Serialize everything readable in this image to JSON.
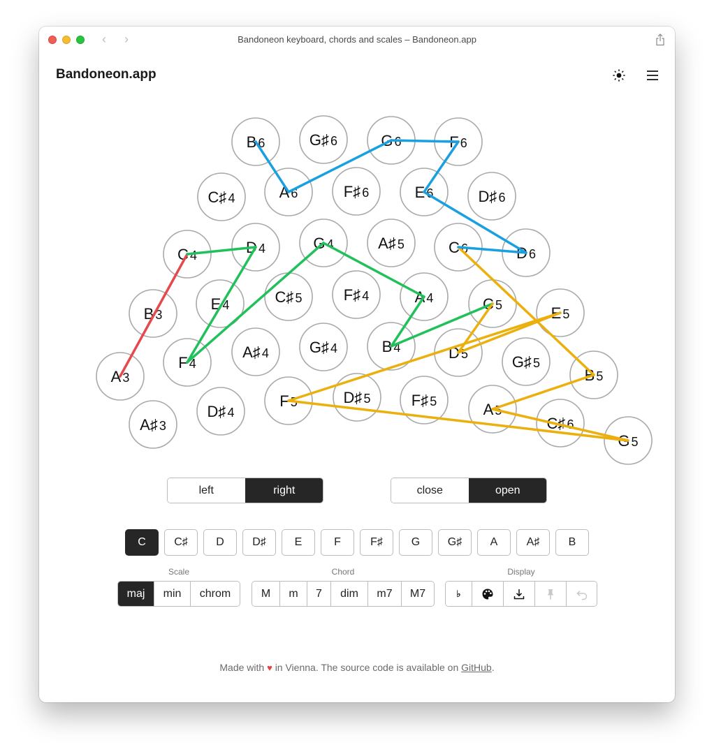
{
  "window": {
    "title": "Bandoneon keyboard, chords and scales – Bandoneon.app",
    "back_glyph": "‹",
    "forward_glyph": "›"
  },
  "header": {
    "app_title": "Bandoneon.app",
    "icons": [
      "theme-toggle-icon",
      "menu-icon"
    ]
  },
  "keyboard": {
    "side": "right",
    "direction": "open",
    "colors": {
      "octave3": "#e5484d",
      "octave4": "#22c05a",
      "octave5": "#ebb00e",
      "octave6": "#1a9fe0",
      "key_stroke": "#a9a9a9"
    },
    "keys": [
      {
        "note": "B",
        "octave": "6"
      },
      {
        "note": "G♯",
        "octave": "6"
      },
      {
        "note": "G",
        "octave": "6"
      },
      {
        "note": "F",
        "octave": "6"
      },
      {
        "note": "C♯",
        "octave": "4"
      },
      {
        "note": "A",
        "octave": "6"
      },
      {
        "note": "F♯",
        "octave": "6"
      },
      {
        "note": "E",
        "octave": "6"
      },
      {
        "note": "D♯",
        "octave": "6"
      },
      {
        "note": "C",
        "octave": "4"
      },
      {
        "note": "D",
        "octave": "4"
      },
      {
        "note": "G",
        "octave": "4"
      },
      {
        "note": "A♯",
        "octave": "5"
      },
      {
        "note": "C",
        "octave": "6"
      },
      {
        "note": "D",
        "octave": "6"
      },
      {
        "note": "B",
        "octave": "3"
      },
      {
        "note": "E",
        "octave": "4"
      },
      {
        "note": "C♯",
        "octave": "5"
      },
      {
        "note": "F♯",
        "octave": "4"
      },
      {
        "note": "A",
        "octave": "4"
      },
      {
        "note": "C",
        "octave": "5"
      },
      {
        "note": "E",
        "octave": "5"
      },
      {
        "note": "A",
        "octave": "3"
      },
      {
        "note": "F",
        "octave": "4"
      },
      {
        "note": "A♯",
        "octave": "4"
      },
      {
        "note": "G♯",
        "octave": "4"
      },
      {
        "note": "B",
        "octave": "4"
      },
      {
        "note": "D",
        "octave": "5"
      },
      {
        "note": "G♯",
        "octave": "5"
      },
      {
        "note": "B",
        "octave": "5"
      },
      {
        "note": "A♯",
        "octave": "3"
      },
      {
        "note": "D♯",
        "octave": "4"
      },
      {
        "note": "F",
        "octave": "5"
      },
      {
        "note": "D♯",
        "octave": "5"
      },
      {
        "note": "F♯",
        "octave": "5"
      },
      {
        "note": "A",
        "octave": "5"
      },
      {
        "note": "C♯",
        "octave": "6"
      },
      {
        "note": "G",
        "octave": "5"
      }
    ],
    "scale_path": [
      {
        "from": "A3",
        "to": "C4",
        "group": "octave3"
      },
      {
        "from": "C4",
        "to": "D4",
        "group": "octave4"
      },
      {
        "from": "D4",
        "to": "F4",
        "group": "octave4"
      },
      {
        "from": "F4",
        "to": "G4",
        "group": "octave4"
      },
      {
        "from": "G4",
        "to": "A4",
        "group": "octave4"
      },
      {
        "from": "A4",
        "to": "B4",
        "group": "octave4"
      },
      {
        "from": "B4",
        "to": "C5",
        "group": "octave4"
      },
      {
        "from": "C5",
        "to": "D5",
        "group": "octave5"
      },
      {
        "from": "D5",
        "to": "E5",
        "group": "octave5"
      },
      {
        "from": "E5",
        "to": "F5",
        "group": "octave5"
      },
      {
        "from": "F5",
        "to": "G5",
        "group": "octave5"
      },
      {
        "from": "G5",
        "to": "A5",
        "group": "octave5"
      },
      {
        "from": "A5",
        "to": "B5",
        "group": "octave5"
      },
      {
        "from": "B5",
        "to": "C6",
        "group": "octave5"
      },
      {
        "from": "C6",
        "to": "D6",
        "group": "octave6"
      },
      {
        "from": "D6",
        "to": "E6",
        "group": "octave6"
      },
      {
        "from": "E6",
        "to": "F6",
        "group": "octave6"
      },
      {
        "from": "F6",
        "to": "G6",
        "group": "octave6"
      },
      {
        "from": "G6",
        "to": "A6",
        "group": "octave6"
      },
      {
        "from": "A6",
        "to": "B6",
        "group": "octave6"
      }
    ]
  },
  "controls": {
    "side_toggle": [
      {
        "label": "left",
        "active": false
      },
      {
        "label": "right",
        "active": true
      }
    ],
    "direction_toggle": [
      {
        "label": "close",
        "active": false
      },
      {
        "label": "open",
        "active": true
      }
    ],
    "root_notes": [
      {
        "label": "C",
        "active": true
      },
      {
        "label": "C♯",
        "active": false
      },
      {
        "label": "D",
        "active": false
      },
      {
        "label": "D♯",
        "active": false
      },
      {
        "label": "E",
        "active": false
      },
      {
        "label": "F",
        "active": false
      },
      {
        "label": "F♯",
        "active": false
      },
      {
        "label": "G",
        "active": false
      },
      {
        "label": "G♯",
        "active": false
      },
      {
        "label": "A",
        "active": false
      },
      {
        "label": "A♯",
        "active": false
      },
      {
        "label": "B",
        "active": false
      }
    ],
    "scale": {
      "label": "Scale",
      "options": [
        {
          "label": "maj",
          "active": true
        },
        {
          "label": "min",
          "active": false
        },
        {
          "label": "chrom",
          "active": false
        }
      ]
    },
    "chord": {
      "label": "Chord",
      "options": [
        {
          "label": "M",
          "active": false
        },
        {
          "label": "m",
          "active": false
        },
        {
          "label": "7",
          "active": false
        },
        {
          "label": "dim",
          "active": false
        },
        {
          "label": "m7",
          "active": false
        },
        {
          "label": "M7",
          "active": false
        }
      ]
    },
    "display": {
      "label": "Display",
      "flat_glyph": "♭",
      "options": [
        "flat-toggle",
        "palette-icon",
        "download-icon",
        "pin-icon",
        "undo-icon"
      ]
    }
  },
  "footer": {
    "prefix": "Made with",
    "heart": "♥",
    "middle": "in Vienna. The source code is available on",
    "link": "GitHub",
    "suffix": "."
  }
}
